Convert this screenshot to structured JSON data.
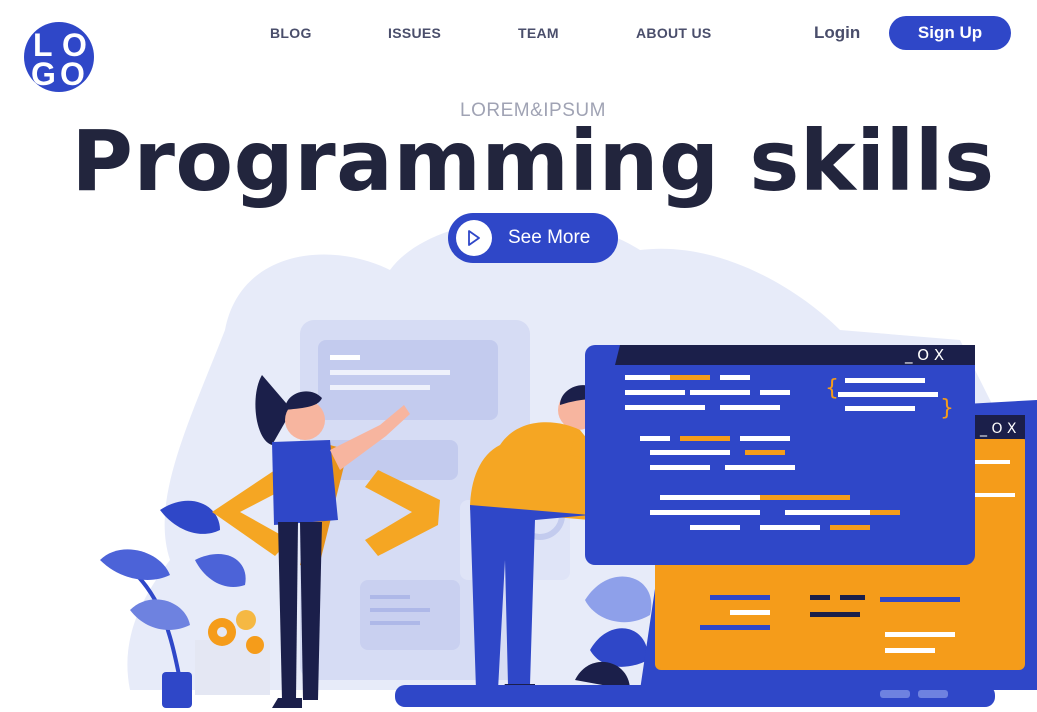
{
  "logo": {
    "letters": [
      "L",
      "O",
      "G",
      "O"
    ]
  },
  "nav": {
    "items": [
      "BLOG",
      "ISSUES",
      "TEAM",
      "ABOUT US"
    ]
  },
  "auth": {
    "login": "Login",
    "signup": "Sign Up"
  },
  "hero": {
    "eyebrow": "LOREM&IPSUM",
    "title": "Programming skills",
    "cta_label": "See More"
  },
  "illustration": {
    "code_symbol": "</>",
    "window_controls": "_ O X"
  },
  "colors": {
    "brand_blue": "#2f47c8",
    "dark_navy": "#22253d",
    "orange": "#f59c1a",
    "pale_blue": "#e7ebf9"
  },
  "icons": [
    "play-icon",
    "close-icon",
    "minimize-icon",
    "maximize-icon"
  ]
}
